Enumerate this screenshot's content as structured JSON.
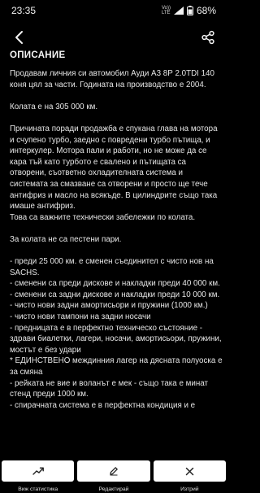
{
  "status_bar": {
    "time": "23:35",
    "signal_top": "Vo))",
    "signal_bottom": "LTE",
    "battery": "68%"
  },
  "header": {
    "back_icon": "back-arrow-icon",
    "share_icon": "share-icon"
  },
  "section_title": "ОПИСАНИЕ",
  "description": {
    "p1": "Продавам личния си автомобил Ауди А3 8Р 2.0TDI 140 коня цял за части. Годината на производство е 2004.",
    "p2": "Колата е на 305 000 км.",
    "p3": "Причината поради продажба е спукана глава на мотора и счупено турбо, заедно с повредени турбо пътища, и интеркулер. Мотора пали и работи, но не може да се кара тъй като турбото е свалено и пътищата са отворени, съответно охладителната система и системата за смазване са отворени и просто ще тече антифриз и масло на всякъде. В цилиндрите също така имаше антифриз.",
    "p3b": "Това са важните технически забележки по колата.",
    "p4": "За колата не са пестени пари.",
    "list": [
      "- преди 25 000 км. е сменен съединител с чисто нов на SACHS.",
      "- сменени са преди дискове и накладки преди 40 000 км.",
      "- сменени са задни дискове и накладки преди 10 000 км.",
      "- чисто нови задни амортисьори и пружини (1000 км.)",
      "- чисто нови тампони на задни носачи",
      "- предницата е в перфектно техническо състояние - здрави биалетки, лагери, носачи, амортисьори, пружини, мостът е без удари",
      "* ЕДИНСТВЕНО междинния лагер на дясната полуоска е за смяна",
      "- рейката не вие и воланът е мек - също така е минат стенд преди 1000 км.",
      "- спирачната система е в перфектна кондиция и е"
    ]
  },
  "actions": [
    {
      "label": "Виж статистика",
      "icon": "trend-up-icon"
    },
    {
      "label": "Редактирай",
      "icon": "pencil-icon"
    },
    {
      "label": "Изтрий",
      "icon": "close-icon"
    }
  ]
}
